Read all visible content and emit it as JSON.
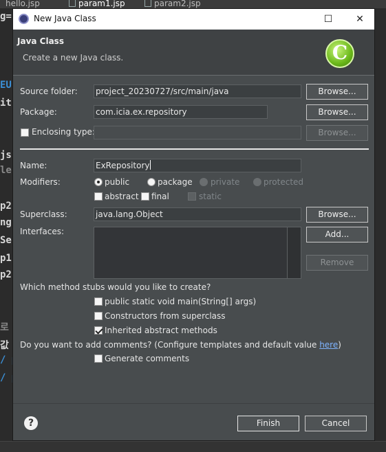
{
  "background": {
    "tabs": [
      "hello.jsp",
      "param1.jsp",
      "param2.jsp"
    ],
    "code_fragments": [
      "g=",
      "EU",
      "it",
      "js",
      "le",
      "p2",
      "ng",
      "Se",
      "p1",
      "p2",
      "로",
      "값",
      "/ p",
      "/ p"
    ]
  },
  "dialog": {
    "window_title": "New Java Class",
    "controls": {
      "maximize": "☐",
      "close": "✕"
    },
    "banner": {
      "heading": "Java Class",
      "subtitle": "Create a new Java class.",
      "icon_letter": "C"
    },
    "source_folder": {
      "label": "Source folder:",
      "value": "project_20230727/src/main/java",
      "button": "Browse..."
    },
    "package": {
      "label": "Package:",
      "value": "com.icia.ex.repository",
      "button": "Browse..."
    },
    "enclosing_type": {
      "label": "Enclosing type:",
      "value": "",
      "button": "Browse..."
    },
    "name": {
      "label": "Name:",
      "value": "ExRepository"
    },
    "modifiers": {
      "label": "Modifiers:",
      "visibility": [
        {
          "label": "public",
          "selected": true,
          "enabled": true
        },
        {
          "label": "package",
          "selected": false,
          "enabled": true
        },
        {
          "label": "private",
          "selected": false,
          "enabled": false
        },
        {
          "label": "protected",
          "selected": false,
          "enabled": false
        }
      ],
      "flags": [
        {
          "label": "abstract",
          "checked": false,
          "enabled": true
        },
        {
          "label": "final",
          "checked": false,
          "enabled": true
        },
        {
          "label": "static",
          "checked": false,
          "enabled": false
        }
      ]
    },
    "superclass": {
      "label": "Superclass:",
      "value": "java.lang.Object",
      "button": "Browse..."
    },
    "interfaces": {
      "label": "Interfaces:",
      "add_button": "Add...",
      "remove_button": "Remove"
    },
    "stubs": {
      "question": "Which method stubs would you like to create?",
      "options": [
        {
          "label": "public static void main(String[] args)",
          "checked": false
        },
        {
          "label": "Constructors from superclass",
          "checked": false
        },
        {
          "label": "Inherited abstract methods",
          "checked": true
        }
      ]
    },
    "comments": {
      "question": "Do you want to add comments? (Configure templates and default value ",
      "link": "here",
      "question_end": ")",
      "option": {
        "label": "Generate comments",
        "checked": false
      }
    },
    "footer": {
      "help": "?",
      "finish": "Finish",
      "cancel": "Cancel"
    }
  }
}
